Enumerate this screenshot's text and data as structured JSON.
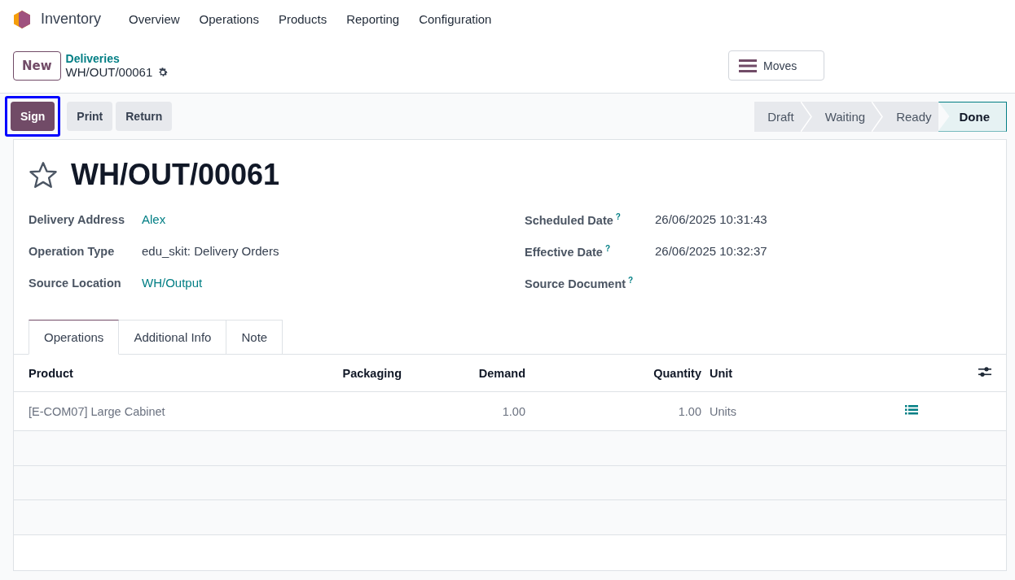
{
  "app": {
    "name": "Inventory"
  },
  "menu": [
    "Overview",
    "Operations",
    "Products",
    "Reporting",
    "Configuration"
  ],
  "control_panel": {
    "new_button": "New",
    "breadcrumb": "Deliveries",
    "record": "WH/OUT/00061",
    "moves_button": "Moves"
  },
  "actions": [
    {
      "label": "Sign",
      "primary": true,
      "highlighted": true
    },
    {
      "label": "Print",
      "primary": false,
      "highlighted": false
    },
    {
      "label": "Return",
      "primary": false,
      "highlighted": false
    }
  ],
  "status_steps": [
    {
      "label": "Draft",
      "selected": false
    },
    {
      "label": "Waiting",
      "selected": false
    },
    {
      "label": "Ready",
      "selected": false
    },
    {
      "label": "Done",
      "selected": true
    }
  ],
  "form": {
    "title": "WH/OUT/00061",
    "starred": false,
    "left_fields": [
      {
        "label": "Delivery Address",
        "value": "Alex",
        "link": true
      },
      {
        "label": "Operation Type",
        "value": "edu_skit: Delivery Orders",
        "link": false
      },
      {
        "label": "Source Location",
        "value": "WH/Output",
        "link": true
      }
    ],
    "right_fields": [
      {
        "label": "Scheduled Date",
        "help": "?",
        "value": "26/06/2025 10:31:43"
      },
      {
        "label": "Effective Date",
        "help": "?",
        "value": "26/06/2025 10:32:37"
      },
      {
        "label": "Source Document",
        "help": "?"
      }
    ]
  },
  "tabs": [
    {
      "label": "Operations",
      "selected": true
    },
    {
      "label": "Additional Info",
      "selected": false
    },
    {
      "label": "Note",
      "selected": false
    }
  ],
  "table": {
    "columns": [
      "Product",
      "Packaging",
      "Demand",
      "Quantity",
      "Unit"
    ],
    "rows": [
      {
        "product": "[E-COM07] Large Cabinet",
        "packaging": "",
        "demand": "1.00",
        "quantity": "1.00",
        "unit": "Units"
      }
    ]
  }
}
